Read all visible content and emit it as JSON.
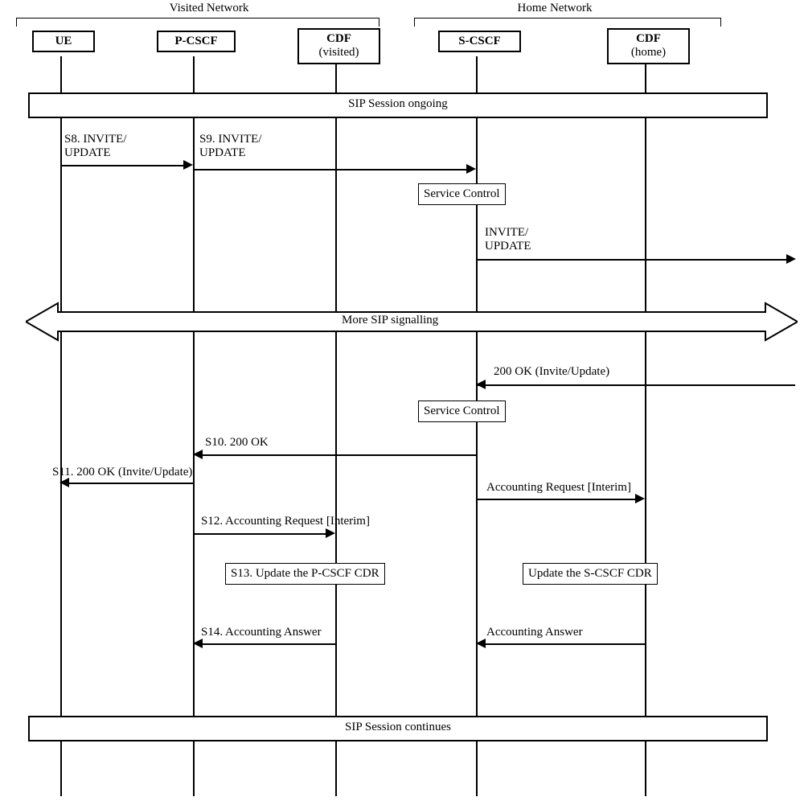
{
  "networks": {
    "visited": "Visited Network",
    "home": "Home Network"
  },
  "entities": {
    "ue": "UE",
    "pcscf": "P-CSCF",
    "cdf_visited_line1": "CDF",
    "cdf_visited_line2": "(visited)",
    "scscf": "S-CSCF",
    "cdf_home_line1": "CDF",
    "cdf_home_line2": "(home)"
  },
  "bands": {
    "ongoing": "SIP Session ongoing",
    "more_sip": "More SIP signalling",
    "continues": "SIP Session continues"
  },
  "notes": {
    "service_control_1": "Service Control",
    "service_control_2": "Service Control",
    "update_pcscf_cdr": "S13. Update the P-CSCF CDR",
    "update_scscf_cdr": "Update the S-CSCF CDR"
  },
  "messages": {
    "s8": "S8. INVITE/\nUPDATE",
    "s9": "S9. INVITE/\nUPDATE",
    "invite_update_right": "INVITE/\nUPDATE",
    "back_200ok": "200 OK (Invite/Update)",
    "s10": "S10. 200 OK",
    "s11": "S11. 200 OK (Invite/Update)",
    "acc_req_interim_right": "Accounting Request [Interim]",
    "s12": "S12. Accounting Request [Interim]",
    "s14": "S14. Accounting Answer",
    "acc_answer_right": "Accounting Answer"
  }
}
